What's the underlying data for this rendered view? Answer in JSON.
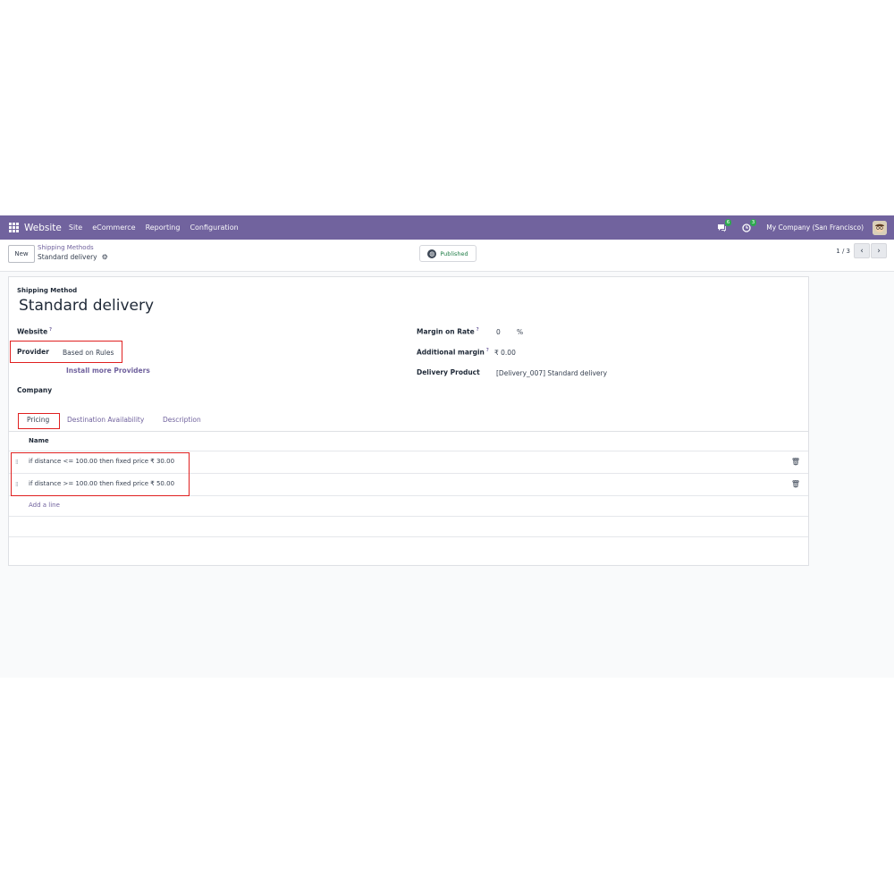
{
  "navbar": {
    "app_name": "Website",
    "menu": [
      "Site",
      "eCommerce",
      "Reporting",
      "Configuration"
    ],
    "messages_count": "6",
    "activity_count": "3",
    "company": "My Company (San Francisco)"
  },
  "control_panel": {
    "new_label": "New",
    "breadcrumb_parent": "Shipping Methods",
    "breadcrumb_current": "Standard delivery",
    "status_label": "Published",
    "pager": "1 / 3"
  },
  "form": {
    "section_label": "Shipping Method",
    "title": "Standard delivery",
    "website_label": "Website",
    "provider_label": "Provider",
    "provider_value": "Based on Rules",
    "install_link": "Install more Providers",
    "company_label": "Company",
    "margin_rate_label": "Margin on Rate",
    "margin_rate_value": "0",
    "margin_rate_unit": "%",
    "additional_margin_label": "Additional margin",
    "additional_margin_value": "₹ 0.00",
    "delivery_product_label": "Delivery Product",
    "delivery_product_value": "[Delivery_007] Standard delivery",
    "help_mark": "?"
  },
  "tabs": [
    "Pricing",
    "Destination Availability",
    "Description"
  ],
  "pricing_table": {
    "header": "Name",
    "rows": [
      "if distance <= 100.00 then fixed price ₹ 30.00",
      "if distance >= 100.00 then fixed price ₹ 50.00"
    ],
    "add_line": "Add a line"
  },
  "colors": {
    "navbar": "#71639e",
    "accent": "#71639e",
    "highlight": "#e02020"
  }
}
